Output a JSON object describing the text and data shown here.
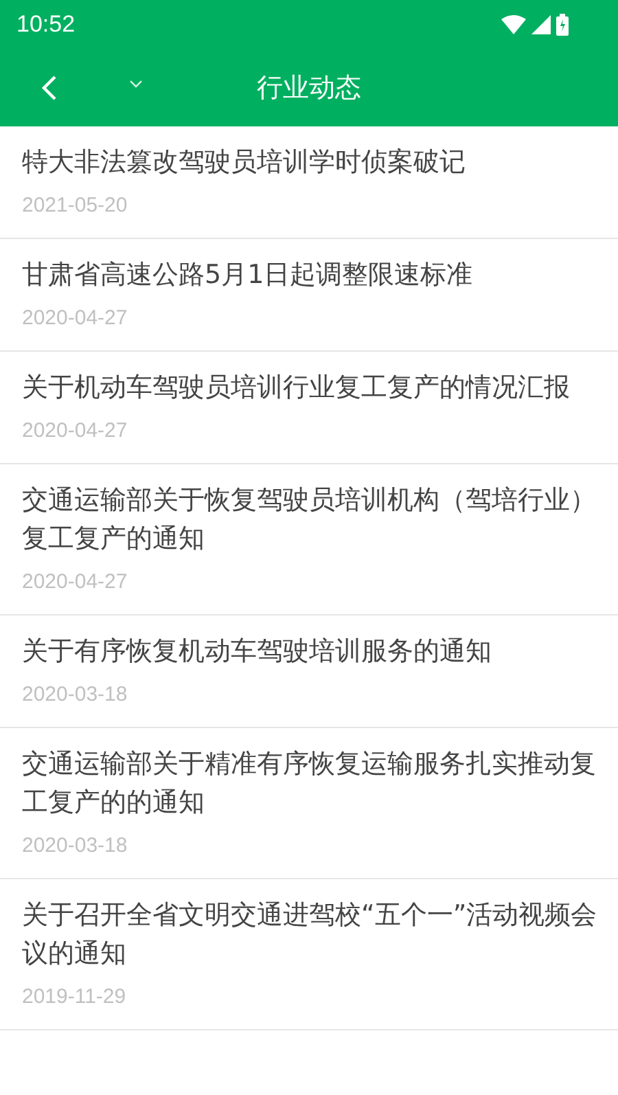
{
  "status_bar": {
    "time": "10:52"
  },
  "header": {
    "title": "行业动态"
  },
  "articles": [
    {
      "title": "特大非法篡改驾驶员培训学时侦案破记",
      "date": "2021-05-20"
    },
    {
      "title": "甘肃省高速公路5月1日起调整限速标准",
      "date": "2020-04-27"
    },
    {
      "title": "关于机动车驾驶员培训行业复工复产的情况汇报",
      "date": "2020-04-27"
    },
    {
      "title": "交通运输部关于恢复驾驶员培训机构（驾培行业）复工复产的通知",
      "date": "2020-04-27"
    },
    {
      "title": "关于有序恢复机动车驾驶培训服务的通知",
      "date": "2020-03-18"
    },
    {
      "title": "交通运输部关于精准有序恢复运输服务扎实推动复工复产的的通知",
      "date": "2020-03-18"
    },
    {
      "title": "关于召开全省文明交通进驾校“五个一”活动视频会议的通知",
      "date": "2019-11-29"
    }
  ]
}
